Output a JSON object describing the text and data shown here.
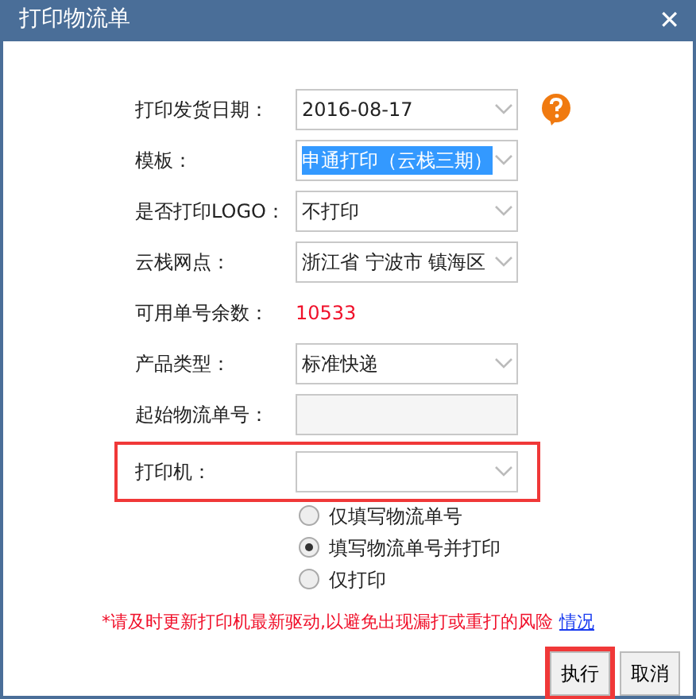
{
  "window": {
    "title": "打印物流单",
    "close": "✕"
  },
  "fields": [
    {
      "kind": "select",
      "label": "打印发货日期：",
      "value": "2016-08-17",
      "help": true
    },
    {
      "kind": "select",
      "label": "模板：",
      "value": "申通打印（云栈三期）",
      "text_selected": true
    },
    {
      "kind": "select",
      "label": "是否打印LOGO：",
      "value": "不打印"
    },
    {
      "kind": "select",
      "label": "云栈网点：",
      "value": "浙江省 宁波市 镇海区"
    },
    {
      "kind": "count",
      "label": "可用单号余数：",
      "value": "10533"
    },
    {
      "kind": "select",
      "label": "产品类型：",
      "value": "标准快递"
    },
    {
      "kind": "input",
      "label": "起始物流单号：",
      "disabled": true
    },
    {
      "kind": "select",
      "label": "打印机：",
      "highlighted": true
    }
  ],
  "options": [
    {
      "label": "仅填写物流单号",
      "selected": false
    },
    {
      "label": "填写物流单号并打印",
      "selected": true
    },
    {
      "label": "仅打印",
      "selected": false
    }
  ],
  "warning": {
    "text": "*请及时更新打印机最新驱动,以避免出现漏打或重打的风险",
    "link": "情况"
  },
  "buttons": [
    {
      "label": "执行",
      "highlighted": true
    },
    {
      "label": "取消",
      "highlighted": false
    }
  ]
}
